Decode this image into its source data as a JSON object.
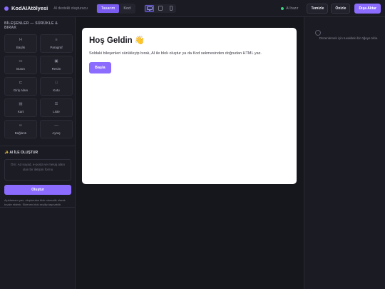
{
  "topbar": {
    "brand": "KodAIAtölyesi",
    "subtitle": "AI destekli oluşturucu",
    "mode_tabs": [
      {
        "label": "Tasarım",
        "active": true
      },
      {
        "label": "Kod",
        "active": false
      }
    ],
    "devices": [
      {
        "icon": "desktop-icon",
        "active": true
      },
      {
        "icon": "tablet-icon",
        "active": false
      },
      {
        "icon": "mobile-icon",
        "active": false
      }
    ],
    "ai_status": "AI hazır",
    "clear_label": "Temizle",
    "preview_label": "Önizle",
    "export_label": "Dışa Aktar"
  },
  "left": {
    "components_title": "BİLEŞENLER — SÜRÜKLE & BIRAK",
    "components": [
      {
        "label": "Başlık",
        "icon": "heading-icon"
      },
      {
        "label": "Paragraf",
        "icon": "paragraph-icon"
      },
      {
        "label": "Buton",
        "icon": "button-icon"
      },
      {
        "label": "Resim",
        "icon": "image-icon"
      },
      {
        "label": "Giriş Alanı",
        "icon": "input-icon"
      },
      {
        "label": "Kutu",
        "icon": "box-icon"
      },
      {
        "label": "Kart",
        "icon": "card-icon"
      },
      {
        "label": "Liste",
        "icon": "list-icon"
      },
      {
        "label": "Bağlantı",
        "icon": "link-icon"
      },
      {
        "label": "Ayraç",
        "icon": "divider-icon"
      }
    ],
    "ai_title": "✨ AI İLE OLUŞTUR",
    "ai_placeholder": "Örn: Ad soyad, e-posta ve mesaj alanı olan bir iletişim formu",
    "generate_label": "Oluştur",
    "ai_hint": "Açıklamanı yaz, oluşturulan blok otomatik olarak tuvale eklenir. Eklenen blok seçilip taşınabilir."
  },
  "canvas": {
    "heading": "Hoş Geldin 👋",
    "paragraph": "Soldaki bileşenleri sürükleyip bırak, AI ile blok oluştur ya da Kod sekmesinden doğrudan HTML yaz.",
    "button_label": "Başla"
  },
  "right": {
    "hint": "Düzenlemek için tuvaldeki bir öğeye tıkla."
  },
  "colors": {
    "accent": "#8b6cff",
    "bg": "#16161d",
    "panel": "#1b1b23",
    "status_ok": "#3ed17e"
  }
}
